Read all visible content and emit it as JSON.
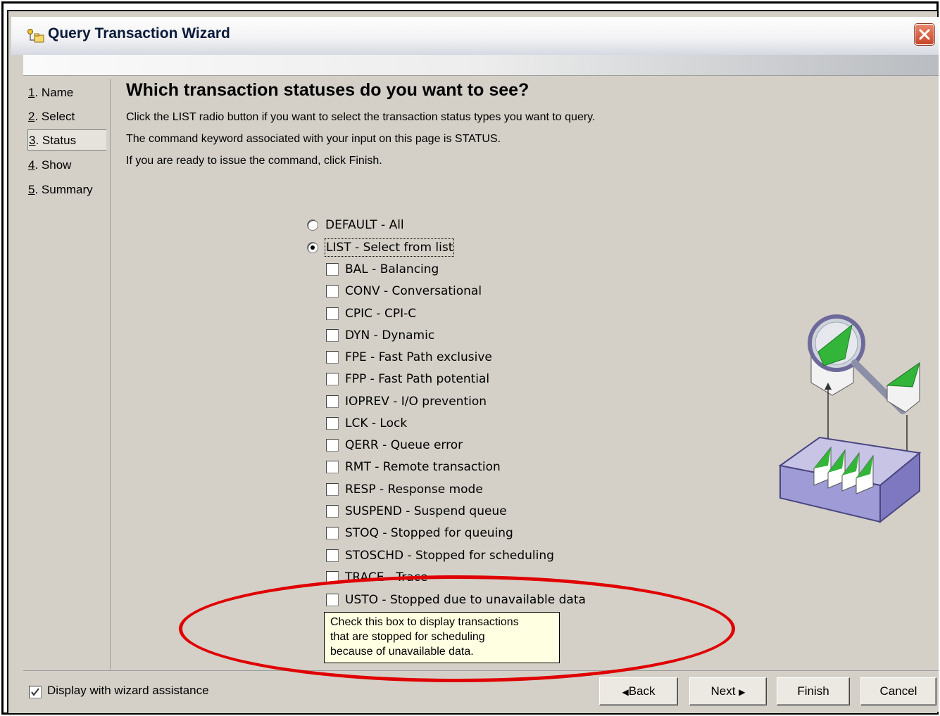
{
  "window": {
    "title": "Query Transaction Wizard",
    "icon": "wizard-icon",
    "close_icon": "close-icon"
  },
  "steps": [
    {
      "num": "1",
      "label": ". Name"
    },
    {
      "num": "2",
      "label": ". Select"
    },
    {
      "num": "3",
      "label": ". Status",
      "active": true
    },
    {
      "num": "4",
      "label": ". Show"
    },
    {
      "num": "5",
      "label": ". Summary"
    }
  ],
  "page": {
    "heading": "Which transaction statuses do you want to see?",
    "line1": "Click the LIST radio button if you want to select the transaction status types you want to query.",
    "line2": "The command keyword associated with your input on this page is STATUS.",
    "line3": "If you are ready to issue the command, click Finish."
  },
  "radios": [
    {
      "label": "DEFAULT - All",
      "selected": false
    },
    {
      "label": "LIST - Select from list",
      "selected": true
    }
  ],
  "checkboxes": [
    {
      "label": "BAL - Balancing"
    },
    {
      "label": "CONV - Conversational"
    },
    {
      "label": "CPIC - CPI-C"
    },
    {
      "label": "DYN - Dynamic"
    },
    {
      "label": "FPE - Fast Path exclusive"
    },
    {
      "label": "FPP - Fast Path potential"
    },
    {
      "label": "IOPREV - I/O prevention"
    },
    {
      "label": "LCK - Lock"
    },
    {
      "label": "QERR - Queue error"
    },
    {
      "label": "RMT - Remote transaction"
    },
    {
      "label": "RESP - Response mode"
    },
    {
      "label": "SUSPEND - Suspend queue"
    },
    {
      "label": "STOQ - Stopped for queuing"
    },
    {
      "label": "STOSCHD - Stopped for scheduling"
    },
    {
      "label": "TRACE - Trace"
    },
    {
      "label": "USTO - Stopped due to unavailable data"
    }
  ],
  "tooltip": {
    "line1": "Check this box to display transactions",
    "line2": "that are stopped for scheduling",
    "line3": "because of unavailable data."
  },
  "footer": {
    "assist_label": "Display with wizard assistance",
    "assist_checked": true,
    "back": "Back",
    "next": "Next",
    "finish": "Finish",
    "cancel": "Cancel"
  },
  "colors": {
    "annotation": "#e00000",
    "tooltip_bg": "#ffffe1",
    "dialog_bg": "#d4d0c8"
  }
}
